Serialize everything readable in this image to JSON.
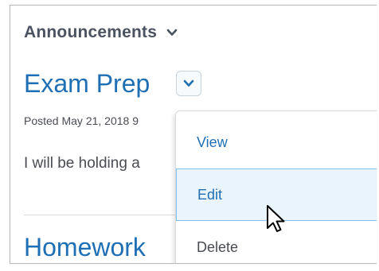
{
  "widget": {
    "title": "Announcements",
    "collapse_icon": "chevron-down-icon"
  },
  "announcements": [
    {
      "title": "Exam Prep",
      "posted": "Posted May 21, 2018 9",
      "body": "I will be holding a"
    },
    {
      "title": "Homework"
    }
  ],
  "context_menu": {
    "toggle_icon": "chevron-down-icon",
    "items": [
      {
        "label": "View"
      },
      {
        "label": "Edit",
        "state": "hover"
      },
      {
        "label": "Delete"
      }
    ]
  },
  "colors": {
    "link_blue": "#1f6fb5",
    "text_gray": "#494c52",
    "hover_bg": "#e9f4fc",
    "hover_border": "#7fc1ea"
  }
}
